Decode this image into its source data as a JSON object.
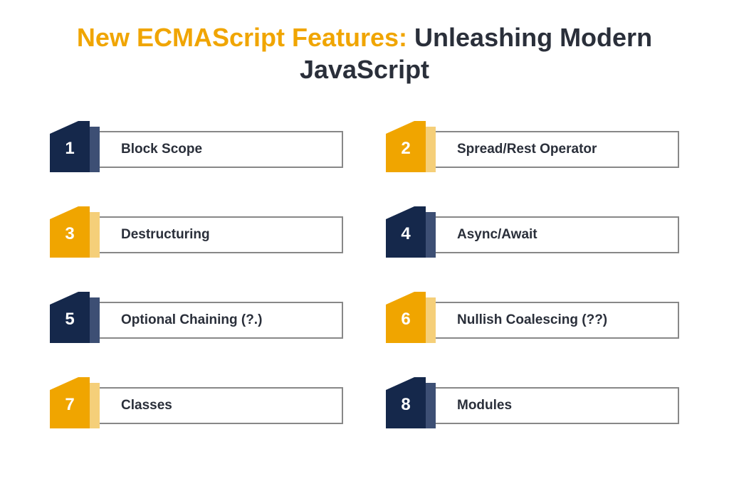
{
  "title": {
    "accent": "New ECMAScript Features:",
    "rest": " Unleashing Modern JavaScript"
  },
  "colors": {
    "navy": "#15284b",
    "navyShadow": "#3d4f74",
    "yellow": "#f0a500",
    "yellowShadow": "#f5cf79"
  },
  "items": [
    {
      "num": "1",
      "label": "Block Scope",
      "scheme": "navy"
    },
    {
      "num": "2",
      "label": "Spread/Rest Operator",
      "scheme": "yellow"
    },
    {
      "num": "3",
      "label": "Destructuring",
      "scheme": "yellow"
    },
    {
      "num": "4",
      "label": "Async/Await",
      "scheme": "navy"
    },
    {
      "num": "5",
      "label": "Optional Chaining (?.)",
      "scheme": "navy"
    },
    {
      "num": "6",
      "label": "Nullish Coalescing (??)",
      "scheme": "yellow"
    },
    {
      "num": "7",
      "label": "Classes",
      "scheme": "yellow"
    },
    {
      "num": "8",
      "label": "Modules",
      "scheme": "navy"
    }
  ]
}
